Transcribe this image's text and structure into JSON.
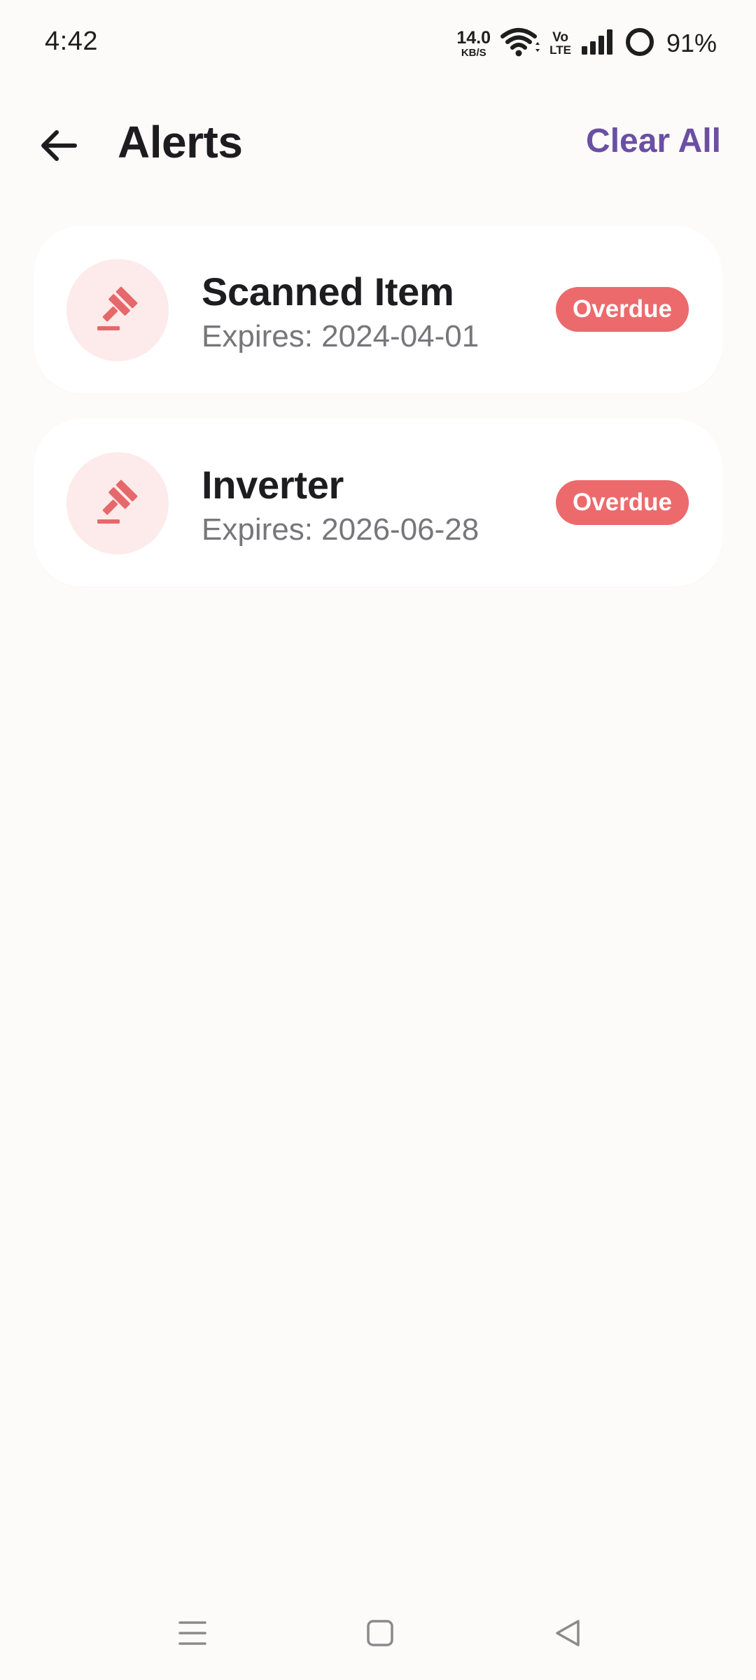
{
  "status_bar": {
    "time": "4:42",
    "net_speed_value": "14.0",
    "net_speed_unit": "KB/S",
    "volte_top": "Vo",
    "volte_bottom": "LTE",
    "battery": "91%"
  },
  "header": {
    "title": "Alerts",
    "clear_all_label": "Clear All",
    "accent_color": "#6a4fa3"
  },
  "alerts": [
    {
      "name": "Scanned Item",
      "expiry": "Expires: 2024-04-01",
      "status": "Overdue",
      "icon": "gavel-icon"
    },
    {
      "name": "Inverter",
      "expiry": "Expires: 2026-06-28",
      "status": "Overdue",
      "icon": "gavel-icon"
    }
  ],
  "colors": {
    "overdue_badge": "#ec6a6c",
    "icon_circle_bg": "#fdeaea",
    "icon_color": "#e5686b",
    "background": "#fcfbfa"
  },
  "nav_bar": {
    "icons": [
      "menu-icon",
      "home-icon",
      "back-triangle-icon"
    ]
  }
}
